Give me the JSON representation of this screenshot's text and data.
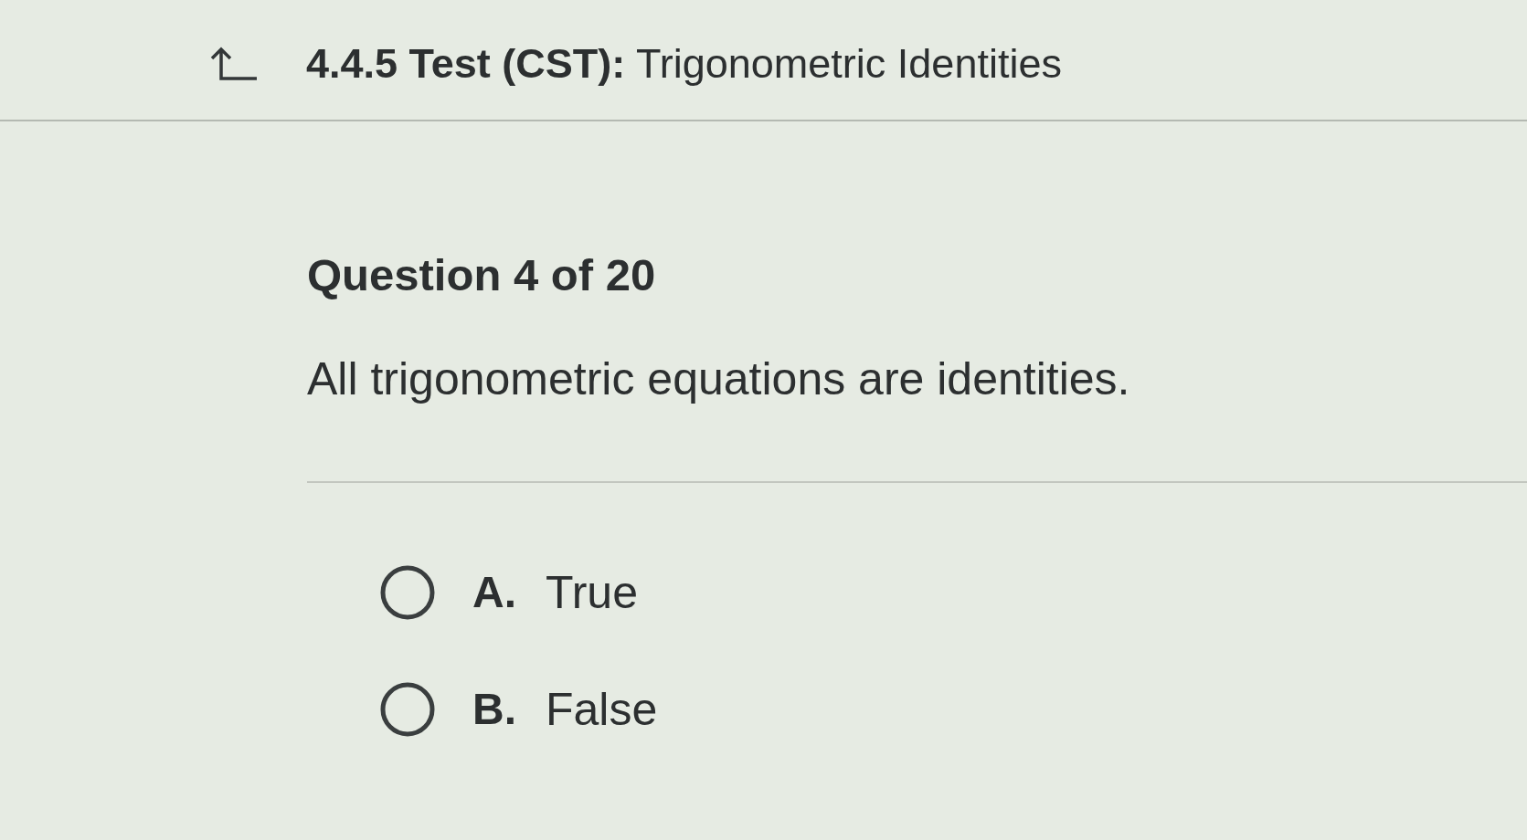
{
  "header": {
    "title": "**4.4.5 Test (CST):** Trigonometric Identities"
  },
  "question": {
    "counter": "Question 4 of 20",
    "prompt": "All trigonometric equations are identities.",
    "options": [
      {
        "letter": "A.",
        "text": "True",
        "selected": false
      },
      {
        "letter": "B.",
        "text": "False",
        "selected": false
      }
    ]
  }
}
